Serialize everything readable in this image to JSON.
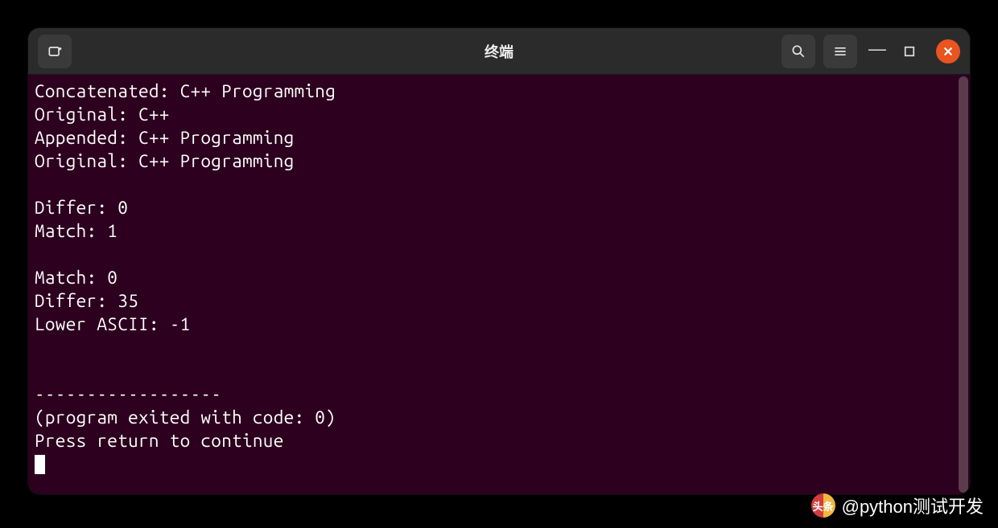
{
  "window": {
    "title": "终端"
  },
  "terminal": {
    "lines": [
      "Concatenated: C++ Programming",
      "Original: C++",
      "Appended: C++ Programming",
      "Original: C++ Programming",
      "",
      "Differ: 0",
      "Match: 1",
      "",
      "Match: 0",
      "Differ: 35",
      "Lower ASCII: -1",
      "",
      "",
      "------------------",
      "(program exited with code: 0)",
      "Press return to continue"
    ]
  },
  "watermark": {
    "logo_text": "头条",
    "handle": "@python测试开发"
  }
}
